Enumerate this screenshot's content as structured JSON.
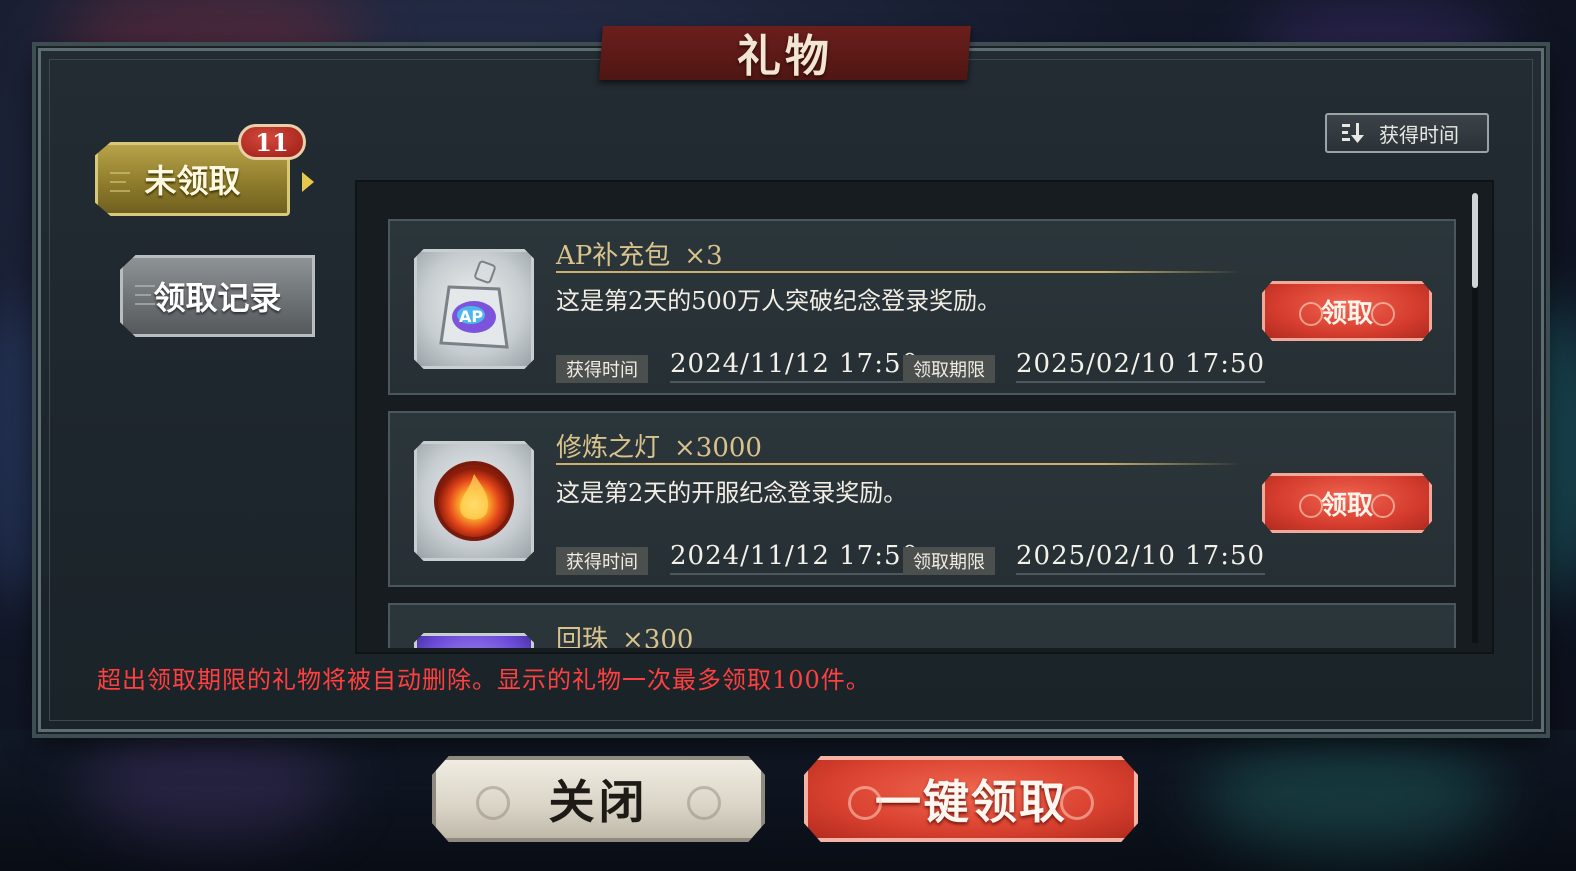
{
  "title": "礼物",
  "sort": {
    "label": "获得时间",
    "icon": "sort-descending-icon"
  },
  "tabs": {
    "unclaimed": {
      "label": "未领取",
      "badge": "11"
    },
    "history": {
      "label": "领取记录"
    }
  },
  "gifts": [
    {
      "name": "AP补充包",
      "qty": "×3",
      "desc": "这是第2天的500万人突破纪念登录奖励。",
      "obtained_label": "获得时间",
      "obtained": "2024/11/12 17:50",
      "deadline_label": "领取期限",
      "deadline": "2025/02/10 17:50",
      "claim_label": "领取",
      "icon": "ap-pack-icon"
    },
    {
      "name": "修炼之灯",
      "qty": "×3000",
      "desc": "这是第2天的开服纪念登录奖励。",
      "obtained_label": "获得时间",
      "obtained": "2024/11/12 17:50",
      "deadline_label": "领取期限",
      "deadline": "2025/02/10 17:50",
      "claim_label": "领取",
      "icon": "lamp-orb-icon"
    },
    {
      "name": "回珠",
      "qty": "×300",
      "icon": "gem-icon"
    }
  ],
  "notice": "超出领取期限的礼物将被自动删除。显示的礼物一次最多领取100件。",
  "buttons": {
    "close": "关闭",
    "claim_all": "一键领取"
  },
  "colors": {
    "accent_red": "#d63d2e",
    "gold": "#d8c38c",
    "notice_red": "#ff4040"
  }
}
